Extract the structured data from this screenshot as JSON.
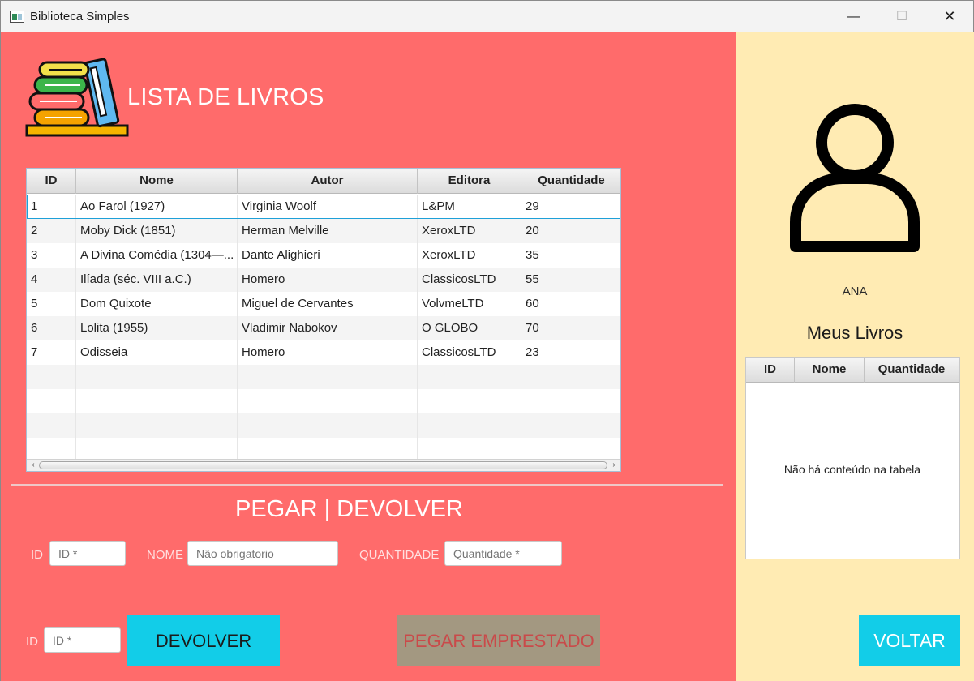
{
  "window": {
    "title": "Biblioteca Simples",
    "minimize": "—",
    "maximize": "☐",
    "close": "✕"
  },
  "colors": {
    "left_panel": "#ff6b6b",
    "right_panel": "#ffebb3",
    "button_cyan": "#12cde8",
    "button_disabled": "#a39881"
  },
  "header": {
    "icon": "books-icon",
    "title": "LISTA DE LIVROS"
  },
  "books_table": {
    "columns": [
      "ID",
      "Nome",
      "Autor",
      "Editora",
      "Quantidade"
    ],
    "rows": [
      {
        "id": "1",
        "nome": "Ao Farol (1927)",
        "autor": "Virginia Woolf",
        "editora": "L&PM",
        "quantidade": "29"
      },
      {
        "id": "2",
        "nome": "Moby Dick (1851)",
        "autor": "Herman Melville",
        "editora": "XeroxLTD",
        "quantidade": "20"
      },
      {
        "id": "3",
        "nome": "A Divina Comédia (1304—...",
        "autor": "Dante Alighieri",
        "editora": "XeroxLTD",
        "quantidade": "35"
      },
      {
        "id": "4",
        "nome": "Ilíada (séc. VIII a.C.)",
        "autor": "Homero",
        "editora": "ClassicosLTD",
        "quantidade": "55"
      },
      {
        "id": "5",
        "nome": "Dom Quixote",
        "autor": "Miguel de Cervantes",
        "editora": "VolvmeLTD",
        "quantidade": "60"
      },
      {
        "id": "6",
        "nome": "Lolita (1955)",
        "autor": "Vladimir Nabokov",
        "editora": "O GLOBO",
        "quantidade": "70"
      },
      {
        "id": "7",
        "nome": "Odisseia",
        "autor": "Homero",
        "editora": "ClassicosLTD",
        "quantidade": "23"
      }
    ]
  },
  "loan_section": {
    "title": "PEGAR | DEVOLVER",
    "id_label": "ID",
    "id_placeholder": "ID *",
    "nome_label": "NOME",
    "nome_placeholder": "Não obrigatorio",
    "quantidade_label": "QUANTIDADE",
    "quantidade_placeholder": "Quantidade *"
  },
  "return_section": {
    "id_label": "ID",
    "id_placeholder": "ID *",
    "devolver_button": "DEVOLVER",
    "pegar_button": "PEGAR EMPRESTADO"
  },
  "user_panel": {
    "icon": "user-icon",
    "name": "ANA",
    "my_books_title": "Meus Livros",
    "columns": [
      "ID",
      "Nome",
      "Quantidade"
    ],
    "empty_message": "Não há conteúdo na tabela",
    "back_button": "VOLTAR"
  }
}
